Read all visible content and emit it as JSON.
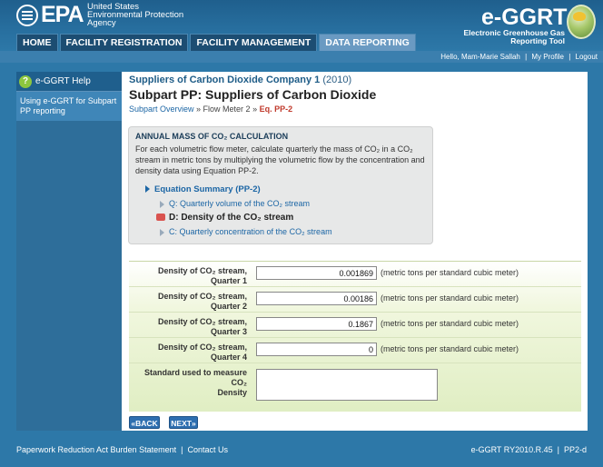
{
  "epa": {
    "logo_text": "EPA",
    "org_line1": "United States",
    "org_line2": "Environmental Protection",
    "org_line3": "Agency"
  },
  "nav": {
    "tabs": [
      {
        "label": "HOME"
      },
      {
        "label": "FACILITY REGISTRATION"
      },
      {
        "label": "FACILITY MANAGEMENT"
      },
      {
        "label": "DATA REPORTING"
      }
    ]
  },
  "brand": {
    "name": "e-GGRT",
    "sub_line1": "Electronic Greenhouse Gas",
    "sub_line2": "Reporting Tool"
  },
  "userbar": {
    "greeting": "Hello, Mam-Marie Sallah",
    "profile": "My Profile",
    "logout": "Logout",
    "sep": "|"
  },
  "sidebar": {
    "help": "e-GGRT Help",
    "help_icon": "?",
    "link": "Using e-GGRT for Subpart PP reporting"
  },
  "header": {
    "company": "Suppliers of Carbon Dioxide Company 1",
    "year": "(2010)",
    "title": "Subpart PP: Suppliers of Carbon Dioxide"
  },
  "breadcrumb": {
    "overview": "Subpart Overview",
    "sep1": " » ",
    "meter": "Flow Meter 2",
    "sep2": " » ",
    "current": "Eq. PP-2"
  },
  "calc": {
    "title": "ANNUAL MASS OF CO₂ CALCULATION",
    "description": "For each volumetric flow meter, calculate quarterly the mass of CO₂ in a CO₂ stream in metric tons by multiplying the volumetric flow by the concentration and density data using Equation PP-2.",
    "summary": "Equation Summary (PP-2)",
    "items": [
      {
        "label": "Q: Quarterly volume of the CO₂ stream"
      },
      {
        "label": "D: Density of the CO₂ stream"
      },
      {
        "label": "C: Quarterly concentration of the CO₂ stream"
      }
    ]
  },
  "form": {
    "unit": "(metric tons per standard cubic meter)",
    "rows": [
      {
        "label_a": "Density of CO₂ stream,",
        "label_b": "Quarter 1",
        "value": "0.001869"
      },
      {
        "label_a": "Density of CO₂ stream,",
        "label_b": "Quarter 2",
        "value": "0.00186"
      },
      {
        "label_a": "Density of CO₂ stream,",
        "label_b": "Quarter 3",
        "value": "0.1867"
      },
      {
        "label_a": "Density of CO₂ stream,",
        "label_b": "Quarter 4",
        "value": "0"
      }
    ],
    "standard_label_a": "Standard used to measure CO₂",
    "standard_label_b": "Density",
    "standard_value": ""
  },
  "buttons": {
    "back": "«BACK",
    "next": "NEXT»"
  },
  "footer": {
    "paperwork": "Paperwork Reduction Act Burden Statement",
    "contact": "Contact Us",
    "sep": "|",
    "version": "e-GGRT RY2010.R.45",
    "page": "PP2-d"
  },
  "colors": {
    "header": "#1f5f8d",
    "accent": "#2d78a8",
    "link": "#1c66a5",
    "current_crumb": "#c0392b",
    "form_green": "#e0eec3"
  }
}
